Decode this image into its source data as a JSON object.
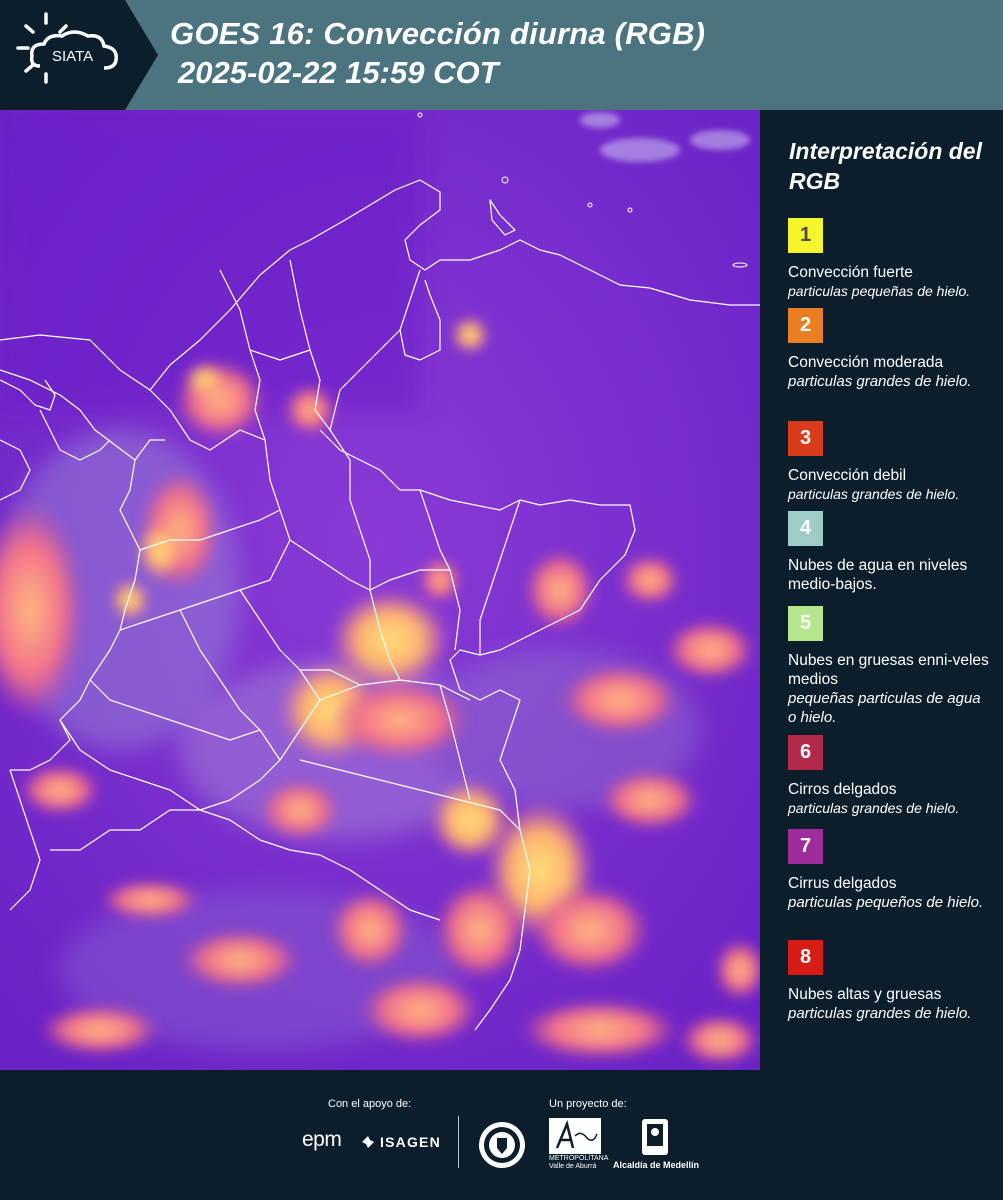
{
  "header": {
    "logo_text": "SIATA",
    "title_line1": "GOES 16: Convección diurna (RGB)",
    "title_line2": "2025-02-22 15:59 COT"
  },
  "map": {
    "description_icon": "satellite-rgb-image-colombia"
  },
  "legend": {
    "title": "Interpretación del RGB",
    "items": [
      {
        "num": "1",
        "color": "#f4f52a",
        "label": "Convección fuerte",
        "sub": "particulas pequeñas de hielo."
      },
      {
        "num": "2",
        "color": "#e97f22",
        "label": "Convección moderada",
        "sub": "particulas grandes de hielo."
      },
      {
        "num": "3",
        "color": "#d93c1b",
        "label": "Convección debil",
        "sub": "particulas grandes de hielo."
      },
      {
        "num": "4",
        "color": "#9ccdc6",
        "label": "Nubes de agua en niveles medio-bajos.",
        "sub": ""
      },
      {
        "num": "5",
        "color": "#b4e78b",
        "label": "Nubes en gruesas enni-veles medios",
        "sub": "pequeñas particulas de agua o hielo."
      },
      {
        "num": "6",
        "color": "#b22a47",
        "label": "Cirros delgados",
        "sub": "particulas grandes de hielo."
      },
      {
        "num": "7",
        "color": "#9e2c9c",
        "label": "Cirrus delgados",
        "sub": "particulas pequeños de hielo."
      },
      {
        "num": "8",
        "color": "#d61c14",
        "label": "Nubes altas y gruesas",
        "sub": "particulas grandes de hielo."
      }
    ]
  },
  "footer": {
    "support_label": "Con el apoyo de:",
    "project_label": "Un proyecto de:",
    "epm": "epm",
    "isagen": "ISAGEN",
    "area_name": "Área",
    "area_sub1": "METROPOLITANA",
    "area_sub2": "Valle de Aburrá",
    "alcaldia": "Alcaldía de Medellín"
  }
}
